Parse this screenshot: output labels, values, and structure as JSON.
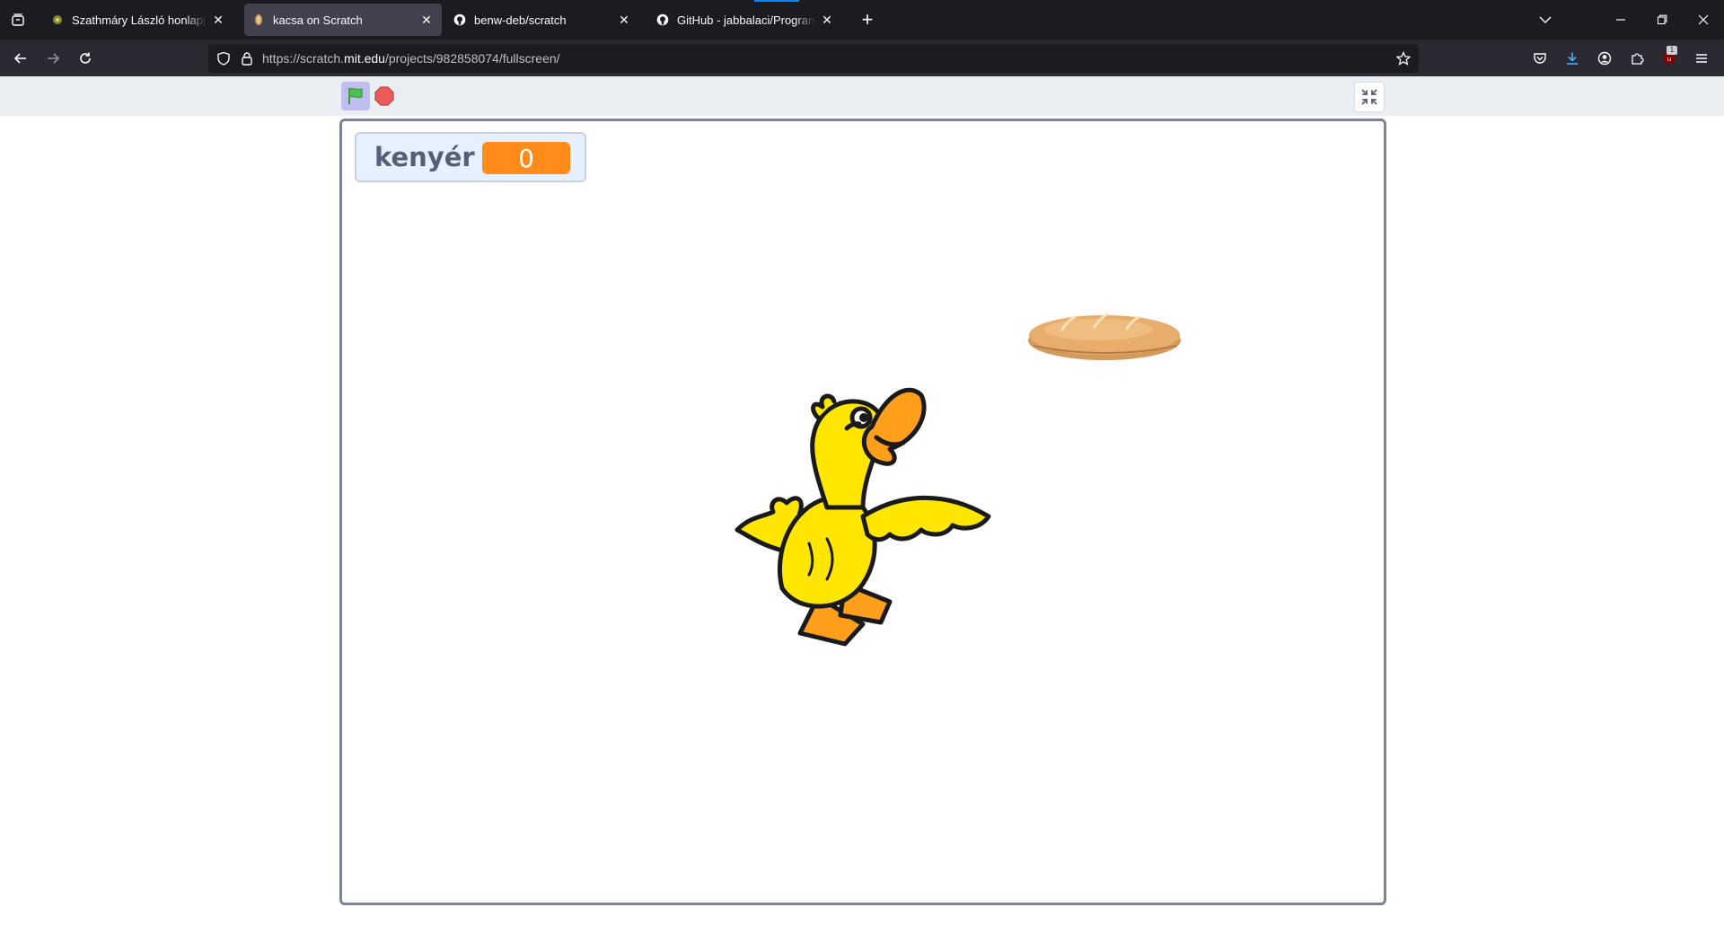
{
  "browser": {
    "tabs": [
      {
        "title": "Szathmáry László honlapja @ DE",
        "icon": "site-favicon"
      },
      {
        "title": "kacsa on Scratch",
        "icon": "scratch-favicon",
        "active": true
      },
      {
        "title": "benw-deb/scratch",
        "icon": "github-icon"
      },
      {
        "title": "GitHub - jabbalaci/Programozas",
        "icon": "github-icon"
      }
    ],
    "url": {
      "prefix": "https://scratch.",
      "host": "mit.edu",
      "path": "/projects/982858074/fullscreen/"
    },
    "extension_badge": "1"
  },
  "player": {
    "monitor": {
      "label": "kenyér",
      "value": "0"
    },
    "sprites": [
      "bread",
      "duck"
    ],
    "colors": {
      "monitor_value": "#ff8c1a",
      "flag_active": "#bfbef0",
      "stage_border": "#7c8396"
    }
  }
}
